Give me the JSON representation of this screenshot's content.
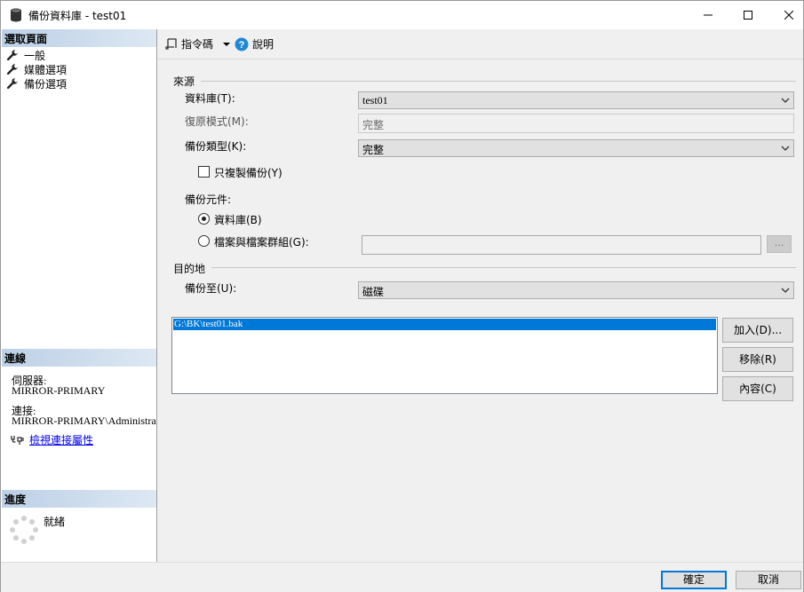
{
  "window": {
    "title": "備份資料庫 - test01"
  },
  "left_panel": {
    "select_page_header": "選取頁面",
    "pages": [
      {
        "label": "一般"
      },
      {
        "label": "媒體選項"
      },
      {
        "label": "備份選項"
      }
    ],
    "connection_header": "連線",
    "server_label": "伺服器:",
    "server_value": "MIRROR-PRIMARY",
    "connection_label": "連接:",
    "connection_value": "MIRROR-PRIMARY\\Administrato",
    "view_connection_link": "檢視連接屬性",
    "progress_header": "進度",
    "progress_status": "就緒"
  },
  "toolbar": {
    "script_label": "指令碼",
    "help_label": "說明"
  },
  "source": {
    "section_title": "來源",
    "database_label": "資料庫(T):",
    "database_value": "test01",
    "recovery_model_label": "復原模式(M):",
    "recovery_model_value": "完整",
    "backup_type_label": "備份類型(K):",
    "backup_type_value": "完整",
    "copy_only_label": "只複製備份(Y)",
    "copy_only_checked": false,
    "component_label": "備份元件:",
    "component_database_label": "資料庫(B)",
    "component_files_label": "檔案與檔案群組(G):",
    "component_selected": "database",
    "browse_label": "..."
  },
  "destination": {
    "section_title": "目的地",
    "backup_to_label": "備份至(U):",
    "backup_to_value": "磁碟",
    "paths": [
      "G:\\BK\\test01.bak"
    ],
    "add_label": "加入(D)...",
    "remove_label": "移除(R)",
    "contents_label": "內容(C)"
  },
  "footer": {
    "ok_label": "確定",
    "cancel_label": "取消"
  },
  "colors": {
    "selection": "#0078d7",
    "panel_header": "#bcd0e6",
    "link": "#0000ee"
  }
}
